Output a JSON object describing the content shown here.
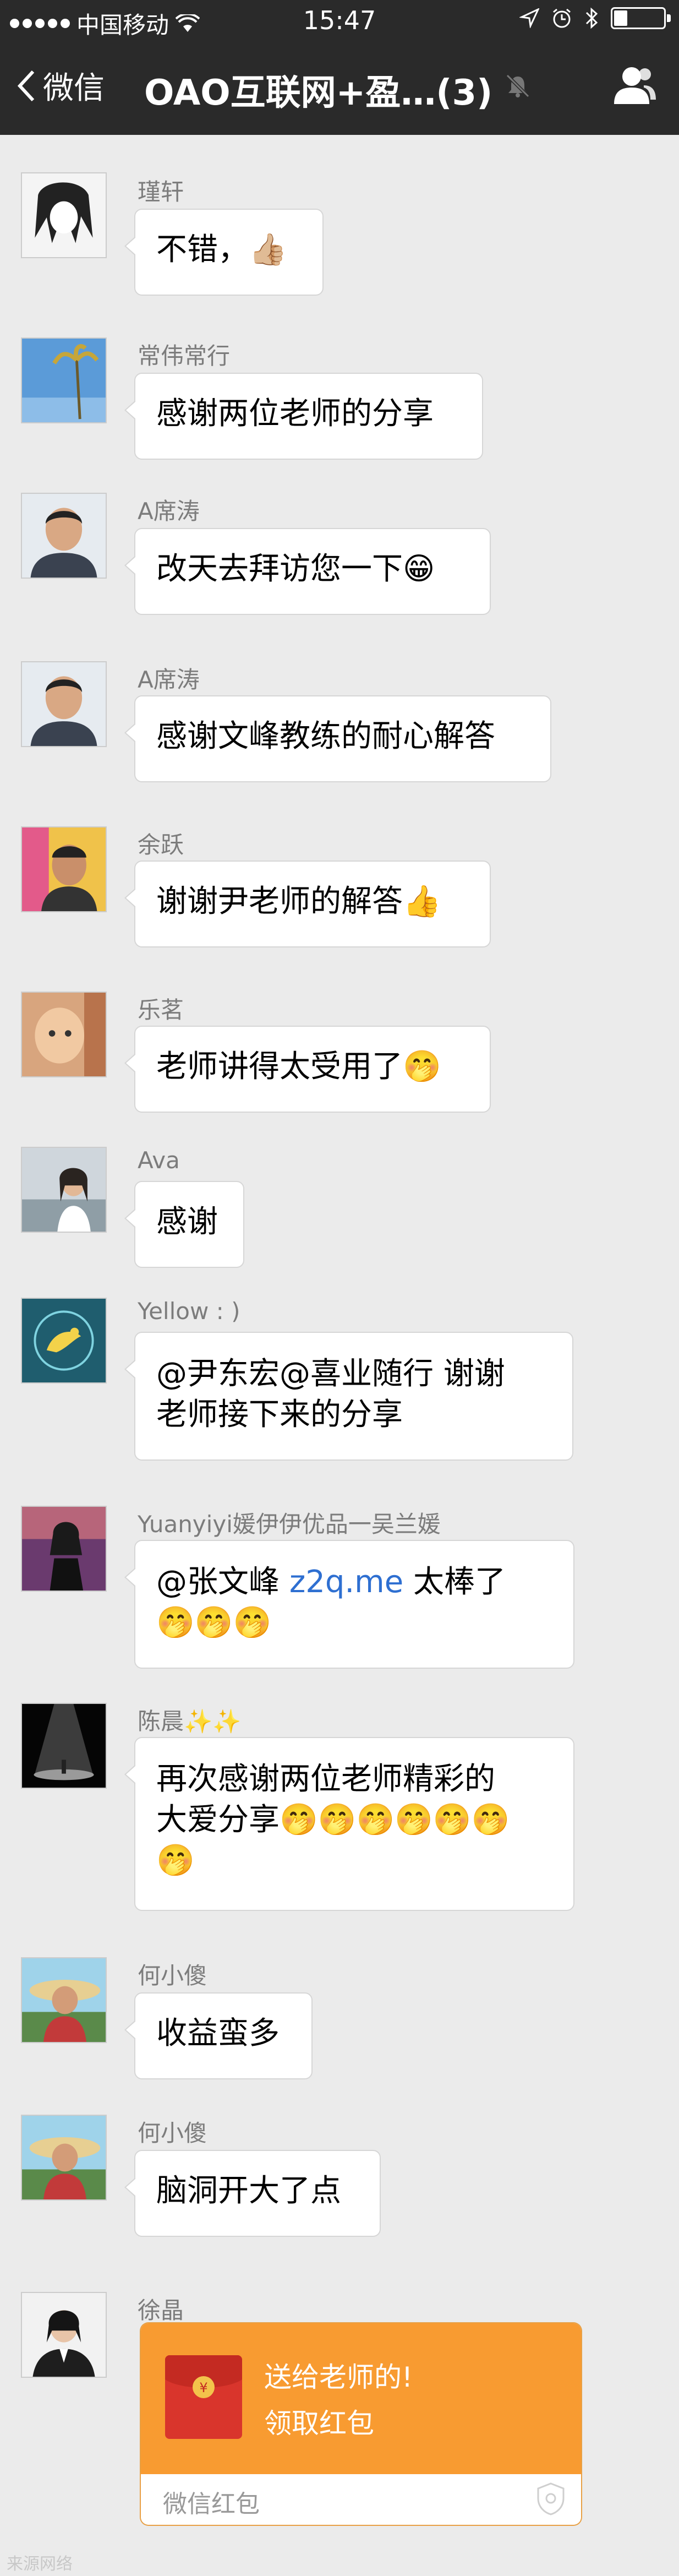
{
  "status_bar": {
    "carrier": "中国移动",
    "time": "15:47"
  },
  "nav": {
    "back_label": "微信",
    "title": "OAO互联网+盈…(3)"
  },
  "messages": [
    {
      "sender": "瑾轩",
      "text": "不错，👍🏼"
    },
    {
      "sender": "常伟常行",
      "text": "感谢两位老师的分享"
    },
    {
      "sender": "A席涛",
      "text": "改天去拜访您一下😁"
    },
    {
      "sender": "A席涛",
      "text": "感谢文峰教练的耐心解答"
    },
    {
      "sender": "余跃",
      "text": "谢谢尹老师的解答👍"
    },
    {
      "sender": "乐茗",
      "text": "老师讲得太受用了🤭"
    },
    {
      "sender": "Ava",
      "text": "感谢"
    },
    {
      "sender": "Yellow : )",
      "line1": "@尹东宏@喜业随行 谢谢",
      "line2": "老师接下来的分享"
    },
    {
      "sender": "Yuanyiyi媛伊伊优品一吴兰媛",
      "prefix": "@张文峰 ",
      "link": "z2q.me",
      "suffix": " 太棒了",
      "line2": "🤭🤭🤭"
    },
    {
      "sender": "陈晨✨✨",
      "line1": "再次感谢两位老师精彩的",
      "line2": "大爱分享🤭🤭🤭🤭🤭🤭",
      "line3": "🤭"
    },
    {
      "sender": "何小傻",
      "text": "收益蛮多"
    },
    {
      "sender": "何小傻",
      "text": "脑洞开大了点"
    },
    {
      "sender": "徐晶"
    }
  ],
  "red_packet": {
    "title": "送给老师的!",
    "action": "领取红包",
    "footer": "微信红包",
    "color": "#f89b31"
  },
  "watermark": "来源网络"
}
